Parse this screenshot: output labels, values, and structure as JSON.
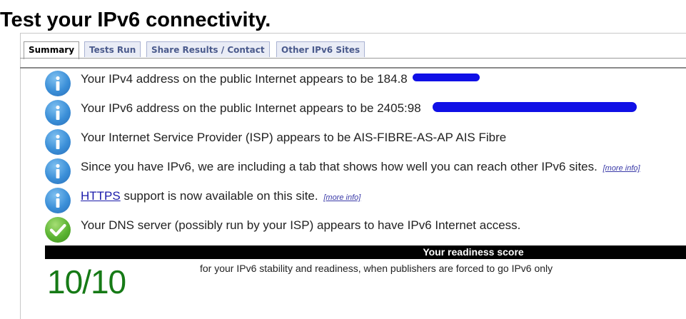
{
  "page": {
    "title": "Test your IPv6 connectivity."
  },
  "tabs": [
    {
      "label": "Summary",
      "active": true
    },
    {
      "label": "Tests Run",
      "active": false
    },
    {
      "label": "Share Results / Contact",
      "active": false
    },
    {
      "label": "Other IPv6 Sites",
      "active": false
    }
  ],
  "messages": [
    {
      "icon": "info-icon",
      "text": "Your IPv4 address on the public Internet appears to be 184.8"
    },
    {
      "icon": "info-icon",
      "text": "Your IPv6 address on the public Internet appears to be 2405:98"
    },
    {
      "icon": "info-icon",
      "text": "Your Internet Service Provider (ISP) appears to be AIS-FIBRE-AS-AP AIS Fibre"
    },
    {
      "icon": "info-icon",
      "text": "Since you have IPv6, we are including a tab that shows how well you can reach other IPv6 sites.",
      "more_info": "[more info]"
    },
    {
      "icon": "info-icon",
      "link": "HTTPS",
      "text": " support is now available on this site.",
      "more_info": "[more info]"
    },
    {
      "icon": "check-icon",
      "text": "Your DNS server (possibly run by your ISP) appears to have IPv6 Internet access."
    }
  ],
  "score": {
    "header": "Your readiness score",
    "value": "10/10",
    "description": "for your IPv6 stability and readiness, when publishers are forced to go IPv6 only"
  },
  "colors": {
    "score_value": "#167a16",
    "redaction": "#1010e6",
    "info_icon": "#3b8fd8",
    "check_icon": "#5ab332"
  }
}
